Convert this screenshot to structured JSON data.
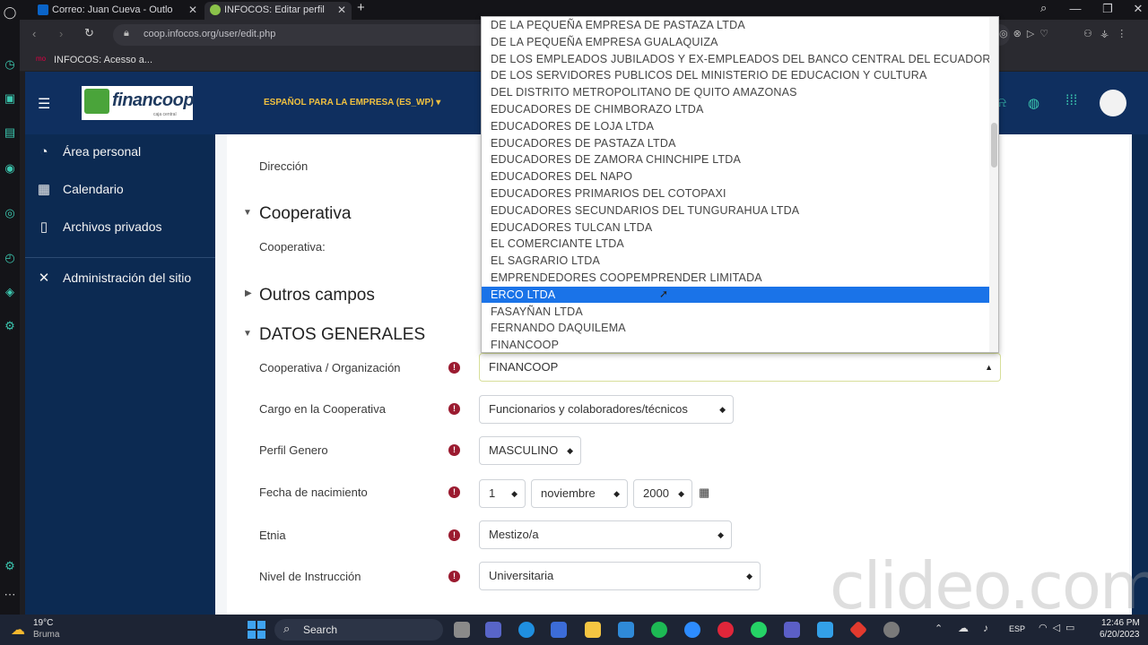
{
  "browser": {
    "tabs": [
      {
        "label": "Correo: Juan Cueva - Outlo",
        "close": "✕"
      },
      {
        "label": "INFOCOS: Editar perfil",
        "close": "✕"
      }
    ],
    "new_tab": "+",
    "url": "coop.infocos.org/user/edit.php",
    "bookmark": "INFOCOS: Acesso a...",
    "window_controls": [
      "—",
      "❐",
      "✕"
    ]
  },
  "header": {
    "logo_text": "financoop",
    "logo_sub": "caja central",
    "language": "ESPAÑOL PARA LA EMPRESA (ES_WP) ▾"
  },
  "nav": {
    "items": [
      {
        "label": "Área personal",
        "icon": "dashboard-icon"
      },
      {
        "label": "Calendario",
        "icon": "calendar-icon"
      },
      {
        "label": "Archivos privados",
        "icon": "file-icon"
      },
      {
        "label": "Administración del sitio",
        "icon": "wrench-icon"
      }
    ]
  },
  "form": {
    "direccion_label": "Dirección",
    "section_cooperativa": "Cooperativa",
    "cooperativa_label": "Cooperativa:",
    "section_outros": "Outros campos",
    "section_datos": "DATOS GENERALES",
    "fields": [
      {
        "label": "Cooperativa / Organización",
        "value": "FINANCOOP"
      },
      {
        "label": "Cargo en la Cooperativa",
        "value": "Funcionarios y colaboradores/técnicos"
      },
      {
        "label": "Perfil Genero",
        "value": "MASCULINO"
      },
      {
        "label": "Fecha de nacimiento",
        "day": "1",
        "month": "noviembre",
        "year": "2000"
      },
      {
        "label": "Etnia",
        "value": "Mestizo/a"
      },
      {
        "label": "Nivel de Instrucción",
        "value": "Universitaria"
      }
    ]
  },
  "dropdown": {
    "options": [
      "DE LA PEQUEÑA EMPRESA DE PASTAZA LTDA",
      "DE LA PEQUEÑA EMPRESA GUALAQUIZA",
      "DE LOS EMPLEADOS JUBILADOS Y EX-EMPLEADOS DEL BANCO CENTRAL DEL ECUADOR",
      "DE LOS SERVIDORES PUBLICOS DEL MINISTERIO DE EDUCACION Y CULTURA",
      "DEL DISTRITO METROPOLITANO DE QUITO AMAZONAS",
      "EDUCADORES DE CHIMBORAZO LTDA",
      "EDUCADORES DE LOJA LTDA",
      "EDUCADORES DE PASTAZA LTDA",
      "EDUCADORES DE ZAMORA CHINCHIPE LTDA",
      "EDUCADORES DEL NAPO",
      "EDUCADORES PRIMARIOS DEL COTOPAXI",
      "EDUCADORES SECUNDARIOS DEL TUNGURAHUA LTDA",
      "EDUCADORES TULCAN LTDA",
      "EL COMERCIANTE LTDA",
      "EL SAGRARIO LTDA",
      "EMPRENDEDORES COOPEMPRENDER LIMITADA",
      "ERCO LTDA",
      "FASAYÑAN LTDA",
      "FERNANDO DAQUILEMA",
      "FINANCOOP"
    ],
    "highlighted": "ERCO LTDA"
  },
  "taskbar": {
    "weather_temp": "19°C",
    "weather_desc": "Bruma",
    "search": "Search",
    "lang": "ESP",
    "time": "12:46 PM",
    "date": "6/20/2023"
  },
  "watermark": "clideo.com"
}
